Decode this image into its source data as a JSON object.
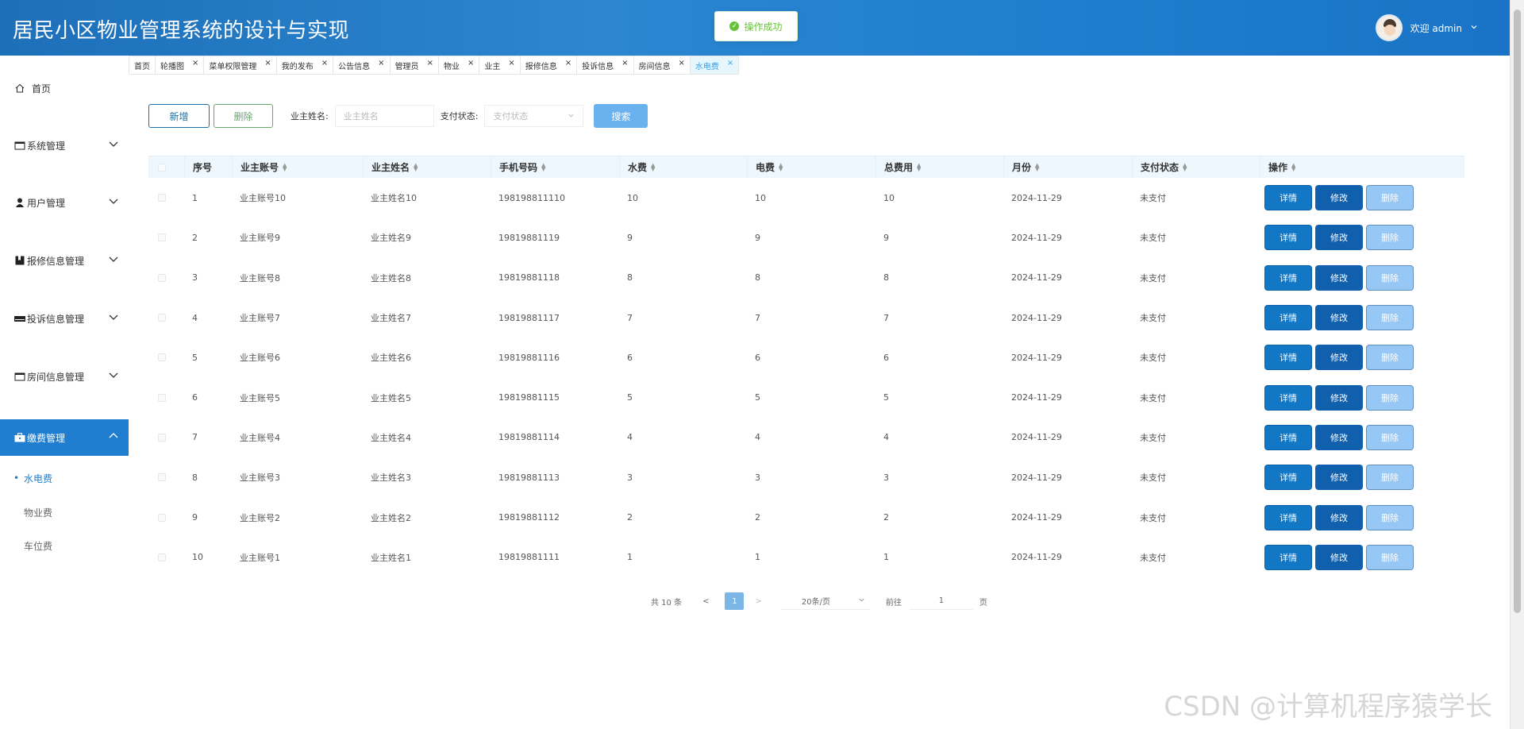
{
  "header": {
    "title": "居民小区物业管理系统的设计与实现",
    "toast": "操作成功",
    "greeting": "欢迎 admin"
  },
  "sidebar": {
    "items": [
      {
        "label": "首页"
      },
      {
        "label": "系统管理"
      },
      {
        "label": "用户管理"
      },
      {
        "label": "报修信息管理"
      },
      {
        "label": "投诉信息管理"
      },
      {
        "label": "房间信息管理"
      },
      {
        "label": "缴费管理"
      }
    ],
    "sub_items": [
      {
        "label": "水电费"
      },
      {
        "label": "物业费"
      },
      {
        "label": "车位费"
      }
    ]
  },
  "tabs": [
    "首页",
    "轮播图",
    "菜单权限管理",
    "我的发布",
    "公告信息",
    "管理员",
    "物业",
    "业主",
    "报修信息",
    "投诉信息",
    "房间信息",
    "水电费"
  ],
  "toolbar": {
    "new_label": "新增",
    "delete_label": "删除",
    "owner_name_label": "业主姓名:",
    "owner_name_placeholder": "业主姓名",
    "pay_status_label": "支付状态:",
    "pay_status_placeholder": "支付状态",
    "search_label": "搜索"
  },
  "table": {
    "headers": [
      "序号",
      "业主账号",
      "业主姓名",
      "手机号码",
      "水费",
      "电费",
      "总费用",
      "月份",
      "支付状态",
      "操作"
    ],
    "rows": [
      [
        "1",
        "业主账号10",
        "业主姓名10",
        "198198811110",
        "10",
        "10",
        "10",
        "2024-11-29",
        "未支付"
      ],
      [
        "2",
        "业主账号9",
        "业主姓名9",
        "19819881119",
        "9",
        "9",
        "9",
        "2024-11-29",
        "未支付"
      ],
      [
        "3",
        "业主账号8",
        "业主姓名8",
        "19819881118",
        "8",
        "8",
        "8",
        "2024-11-29",
        "未支付"
      ],
      [
        "4",
        "业主账号7",
        "业主姓名7",
        "19819881117",
        "7",
        "7",
        "7",
        "2024-11-29",
        "未支付"
      ],
      [
        "5",
        "业主账号6",
        "业主姓名6",
        "19819881116",
        "6",
        "6",
        "6",
        "2024-11-29",
        "未支付"
      ],
      [
        "6",
        "业主账号5",
        "业主姓名5",
        "19819881115",
        "5",
        "5",
        "5",
        "2024-11-29",
        "未支付"
      ],
      [
        "7",
        "业主账号4",
        "业主姓名4",
        "19819881114",
        "4",
        "4",
        "4",
        "2024-11-29",
        "未支付"
      ],
      [
        "8",
        "业主账号3",
        "业主姓名3",
        "19819881113",
        "3",
        "3",
        "3",
        "2024-11-29",
        "未支付"
      ],
      [
        "9",
        "业主账号2",
        "业主姓名2",
        "19819881112",
        "2",
        "2",
        "2",
        "2024-11-29",
        "未支付"
      ],
      [
        "10",
        "业主账号1",
        "业主姓名1",
        "19819881111",
        "1",
        "1",
        "1",
        "2024-11-29",
        "未支付"
      ]
    ],
    "actions": {
      "detail": "详情",
      "edit": "修改",
      "delete": "删除"
    }
  },
  "pagination": {
    "total": "共 10 条",
    "prev": "<",
    "current": "1",
    "next": ">",
    "page_size": "20条/页",
    "goto": "前往",
    "goto_value": "1",
    "page_unit": "页"
  },
  "watermark": "CSDN @计算机程序猿学长",
  "colors": {
    "header": "#1f7ecf",
    "active_menu": "#1f7ecf",
    "toast_success": "#67c23a"
  }
}
